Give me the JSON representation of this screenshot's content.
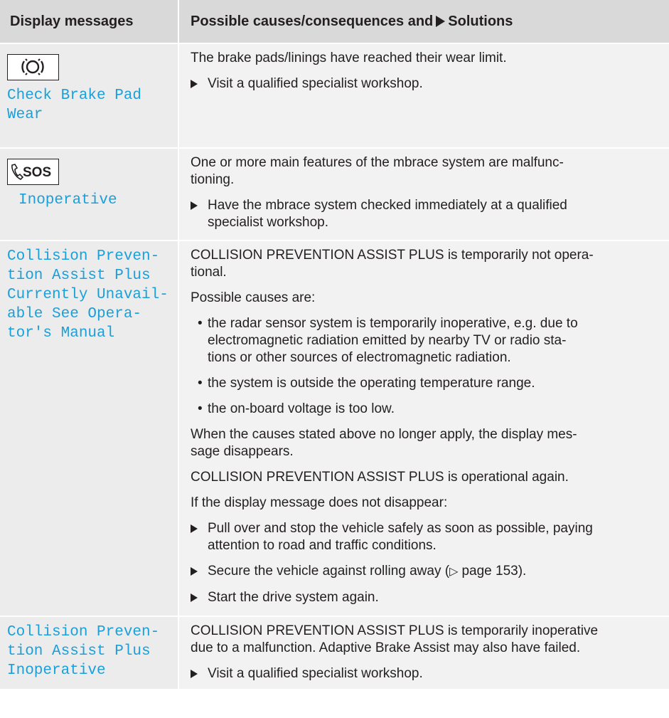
{
  "header": {
    "col1": "Display messages",
    "col2_prefix": "Possible causes/consequences and",
    "col2_suffix": "Solutions"
  },
  "rows": [
    {
      "icon": "brake-pad-wear-icon",
      "display": [
        "Check Brake Pad",
        "Wear"
      ],
      "text": "The brake pads/linings have reached their wear limit.",
      "action": "Visit a qualified specialist workshop."
    },
    {
      "icon": "sos-phone-icon",
      "icon_text": "SOS",
      "display": [
        "Inoperative"
      ],
      "text": [
        "One or more main features of the mbrace system are malfunc-",
        "tioning."
      ],
      "action": [
        "Have the mbrace system checked immediately at a qualified",
        "specialist workshop."
      ]
    },
    {
      "display": [
        "Collision Preven-",
        "tion Assist Plus",
        "Currently Unavail-",
        "able See Opera-",
        "tor's Manual"
      ],
      "p1": [
        "COLLISION PREVENTION ASSIST PLUS is temporarily not opera-",
        "tional."
      ],
      "p2": "Possible causes are:",
      "bullets": [
        [
          "the radar sensor system is temporarily inoperative, e.g. due to",
          "electromagnetic radiation emitted by nearby TV or radio sta-",
          "tions or other sources of electromagnetic radiation."
        ],
        [
          "the system is outside the operating temperature range."
        ],
        [
          "the on-board voltage is too low."
        ]
      ],
      "p3": [
        "When the causes stated above no longer apply, the display mes-",
        "sage disappears."
      ],
      "p4": "COLLISION PREVENTION ASSIST PLUS is operational again.",
      "p5": "If the display message does not disappear:",
      "actions": [
        [
          "Pull over and stop the vehicle safely as soon as possible, paying",
          "attention to road and traffic conditions."
        ],
        [
          "Secure the vehicle against rolling away (",
          "page 153",
          ")."
        ],
        [
          "Start the drive system again."
        ]
      ]
    },
    {
      "display": [
        "Collision Preven-",
        "tion Assist Plus",
        "Inoperative"
      ],
      "text": [
        "COLLISION PREVENTION ASSIST PLUS is temporarily inoperative",
        "due to a malfunction. Adaptive Brake Assist may also have failed."
      ],
      "action": "Visit a qualified specialist workshop."
    }
  ],
  "colors": {
    "display_text": "#1a9fd8",
    "header_bg": "#d9d9d9",
    "cell_bg": "#f2f2f2"
  }
}
